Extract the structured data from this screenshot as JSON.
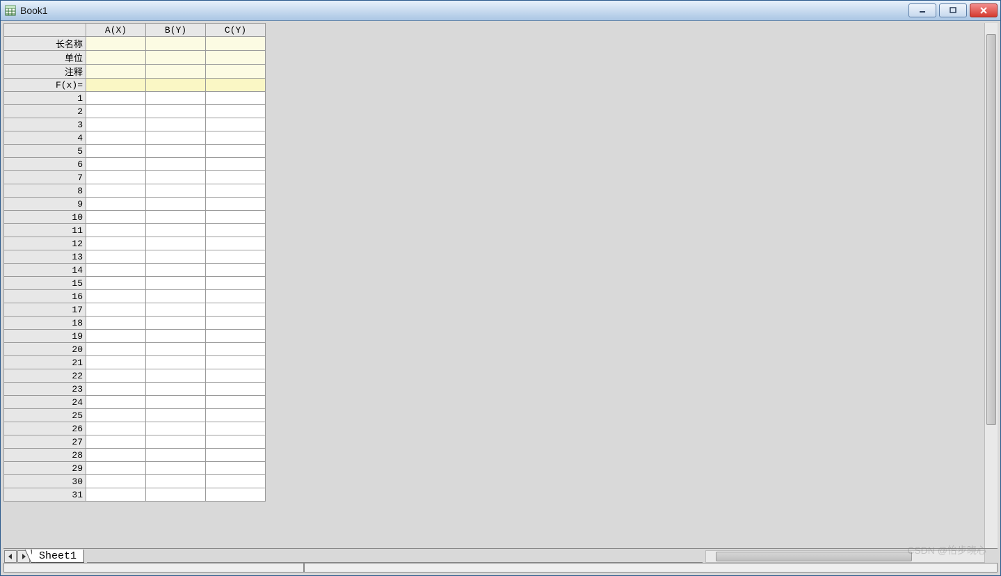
{
  "window": {
    "title": "Book1"
  },
  "columns": [
    {
      "label": "A(X)"
    },
    {
      "label": "B(Y)"
    },
    {
      "label": "C(Y)"
    }
  ],
  "meta_rows": {
    "long_name": "长名称",
    "units": "单位",
    "comments": "注释",
    "fx": "F(x)="
  },
  "row_count": 31,
  "sheet_tab": "Sheet1",
  "watermark": "CSDN @怡步晓心"
}
